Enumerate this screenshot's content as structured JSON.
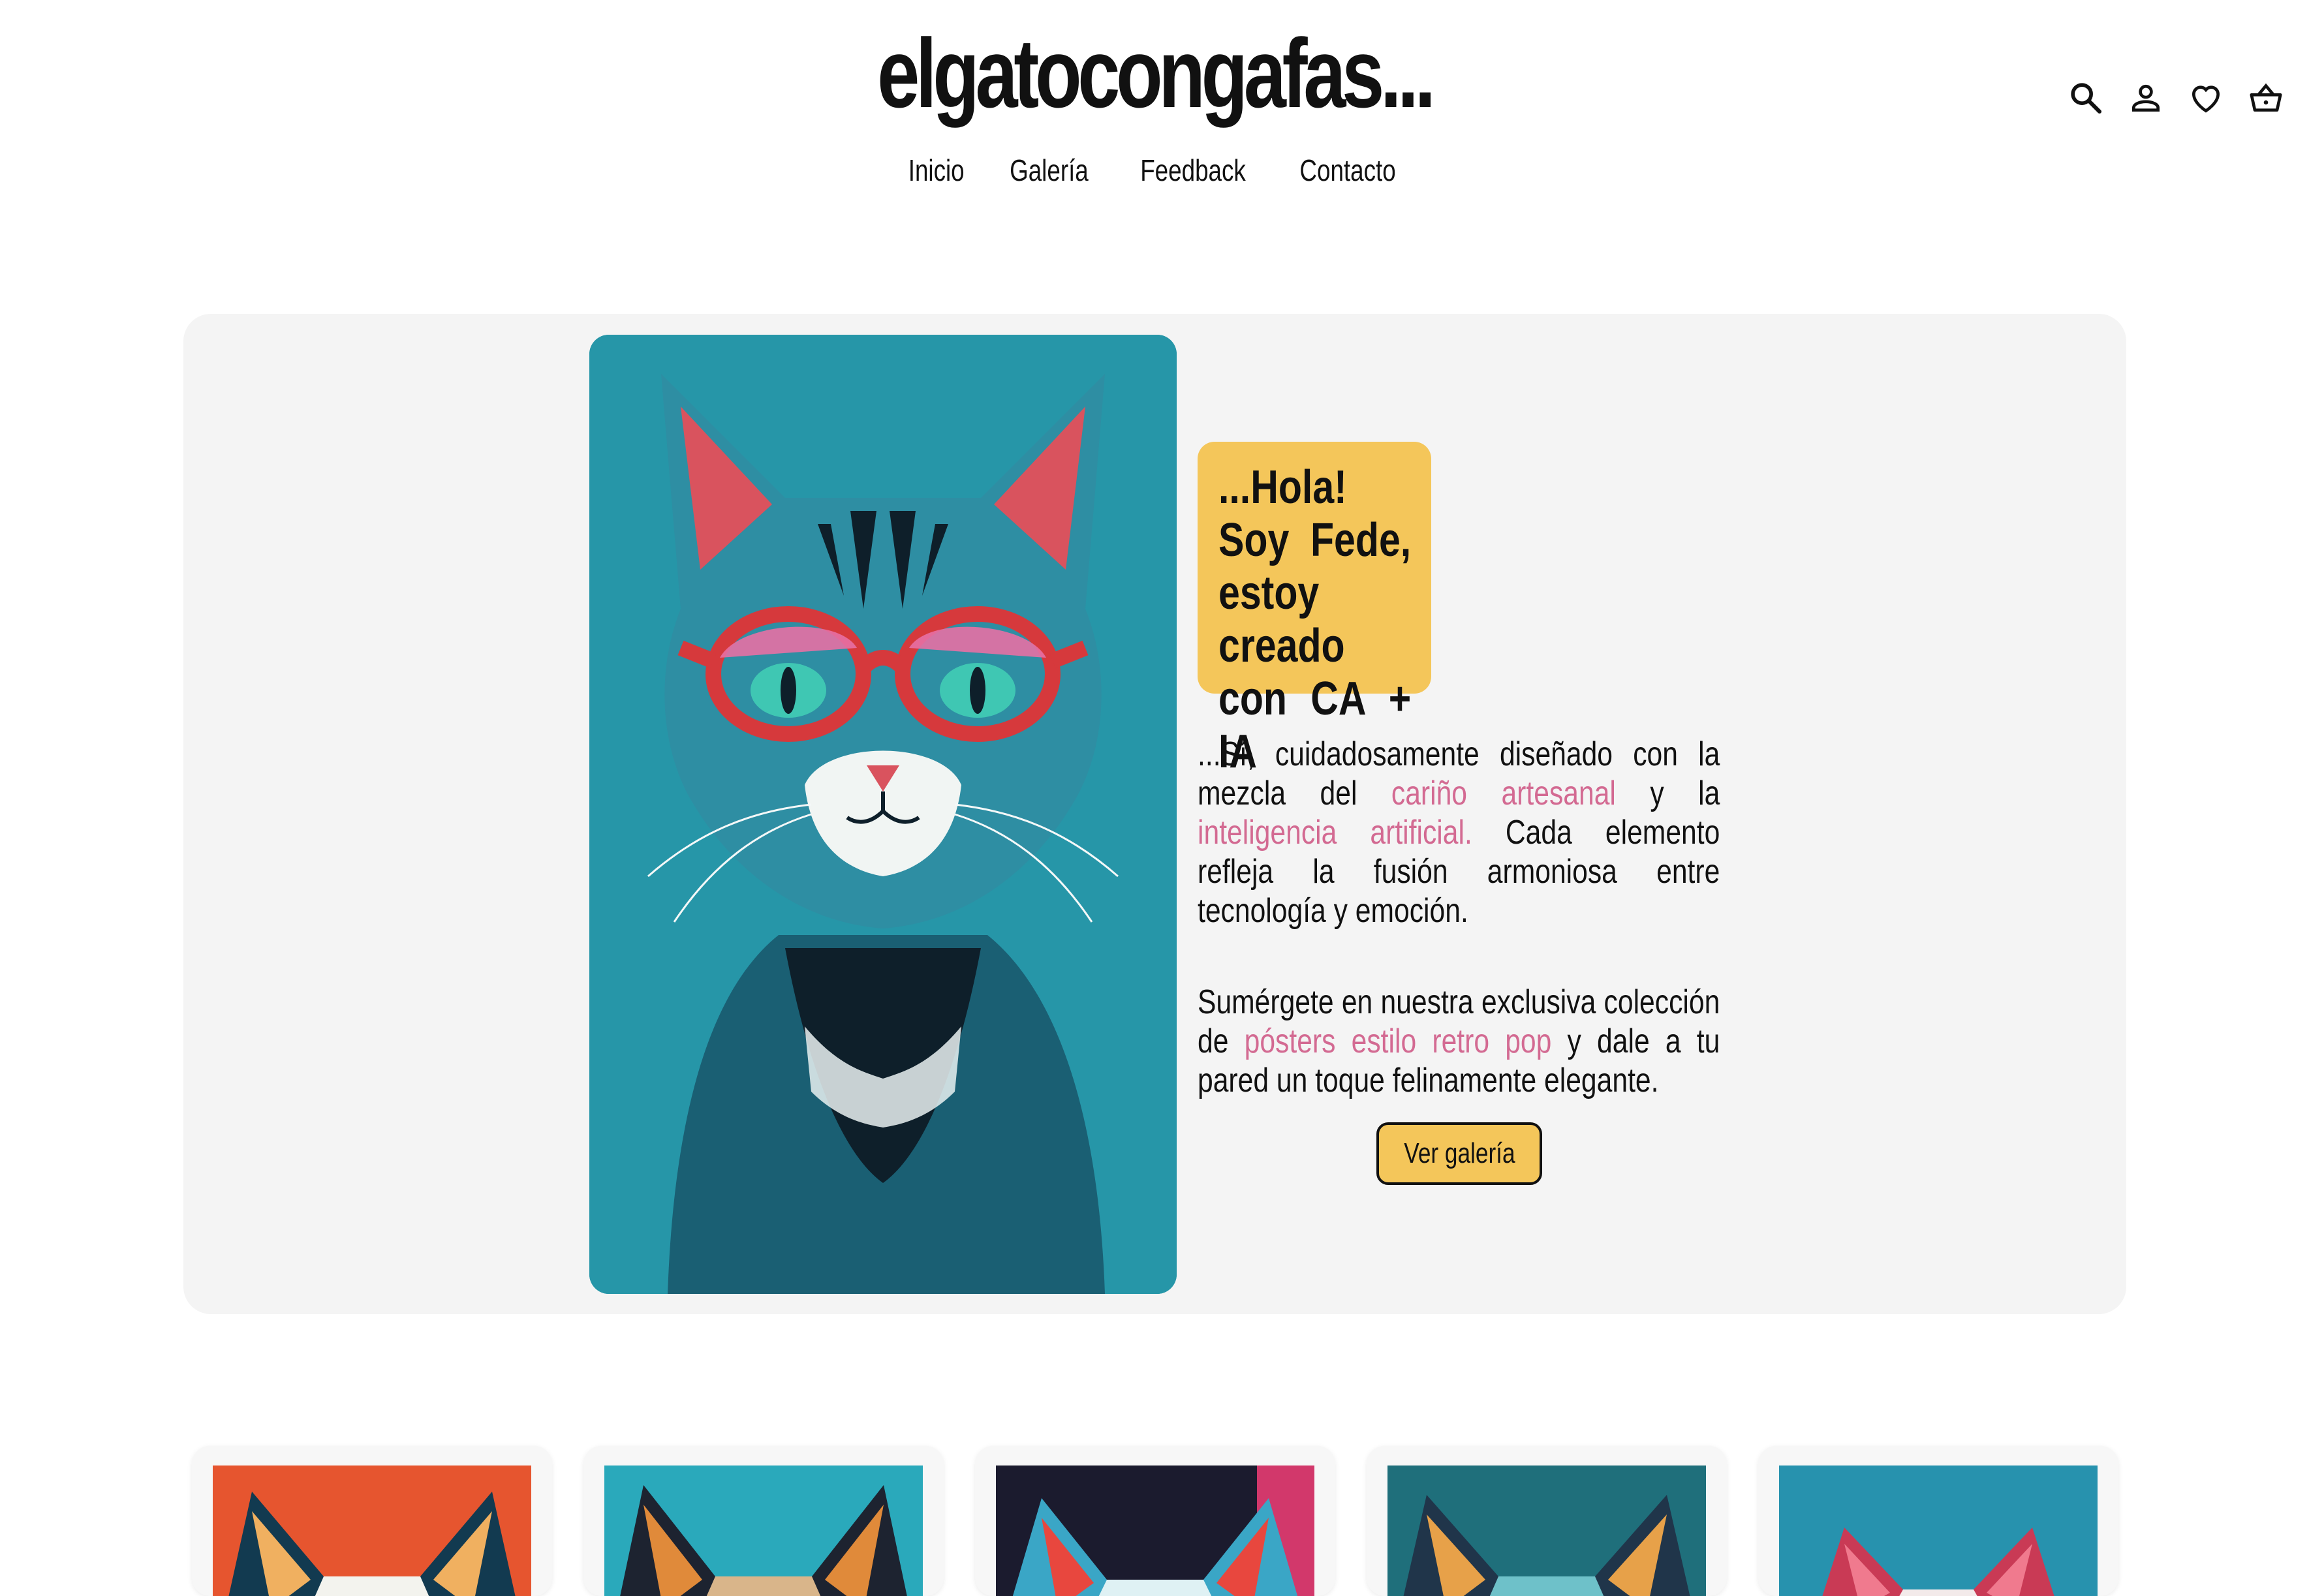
{
  "header": {
    "brand": "elgatocongafas...",
    "nav": [
      "Inicio",
      "Galería",
      "Feedback",
      "Contacto"
    ],
    "icons": [
      "search-icon",
      "account-icon",
      "wishlist-heart-icon",
      "shopping-basket-icon"
    ]
  },
  "hero": {
    "speech": "...Hola! Soy Fede, estoy creado con CA + IA",
    "p1": {
      "a": "...Sí, cuidadosamente diseñado con la mezcla del ",
      "h1": "cariño artesanal",
      "b": " y la ",
      "h2": "inteligencia artificial.",
      "c": " Cada elemento refleja la fusión armoniosa entre tecnología y emoción."
    },
    "p2": {
      "a": "Sumérgete en nuestra exclusiva colección de ",
      "h1": "pósters estilo retro pop",
      "b": " y dale a tu pared un toque felinamente elegante."
    },
    "cta": "Ver galería"
  },
  "colors": {
    "accent_yellow": "#f4c65a",
    "highlight_pink": "#d36a92",
    "hero_bg": "#f4f4f4"
  }
}
